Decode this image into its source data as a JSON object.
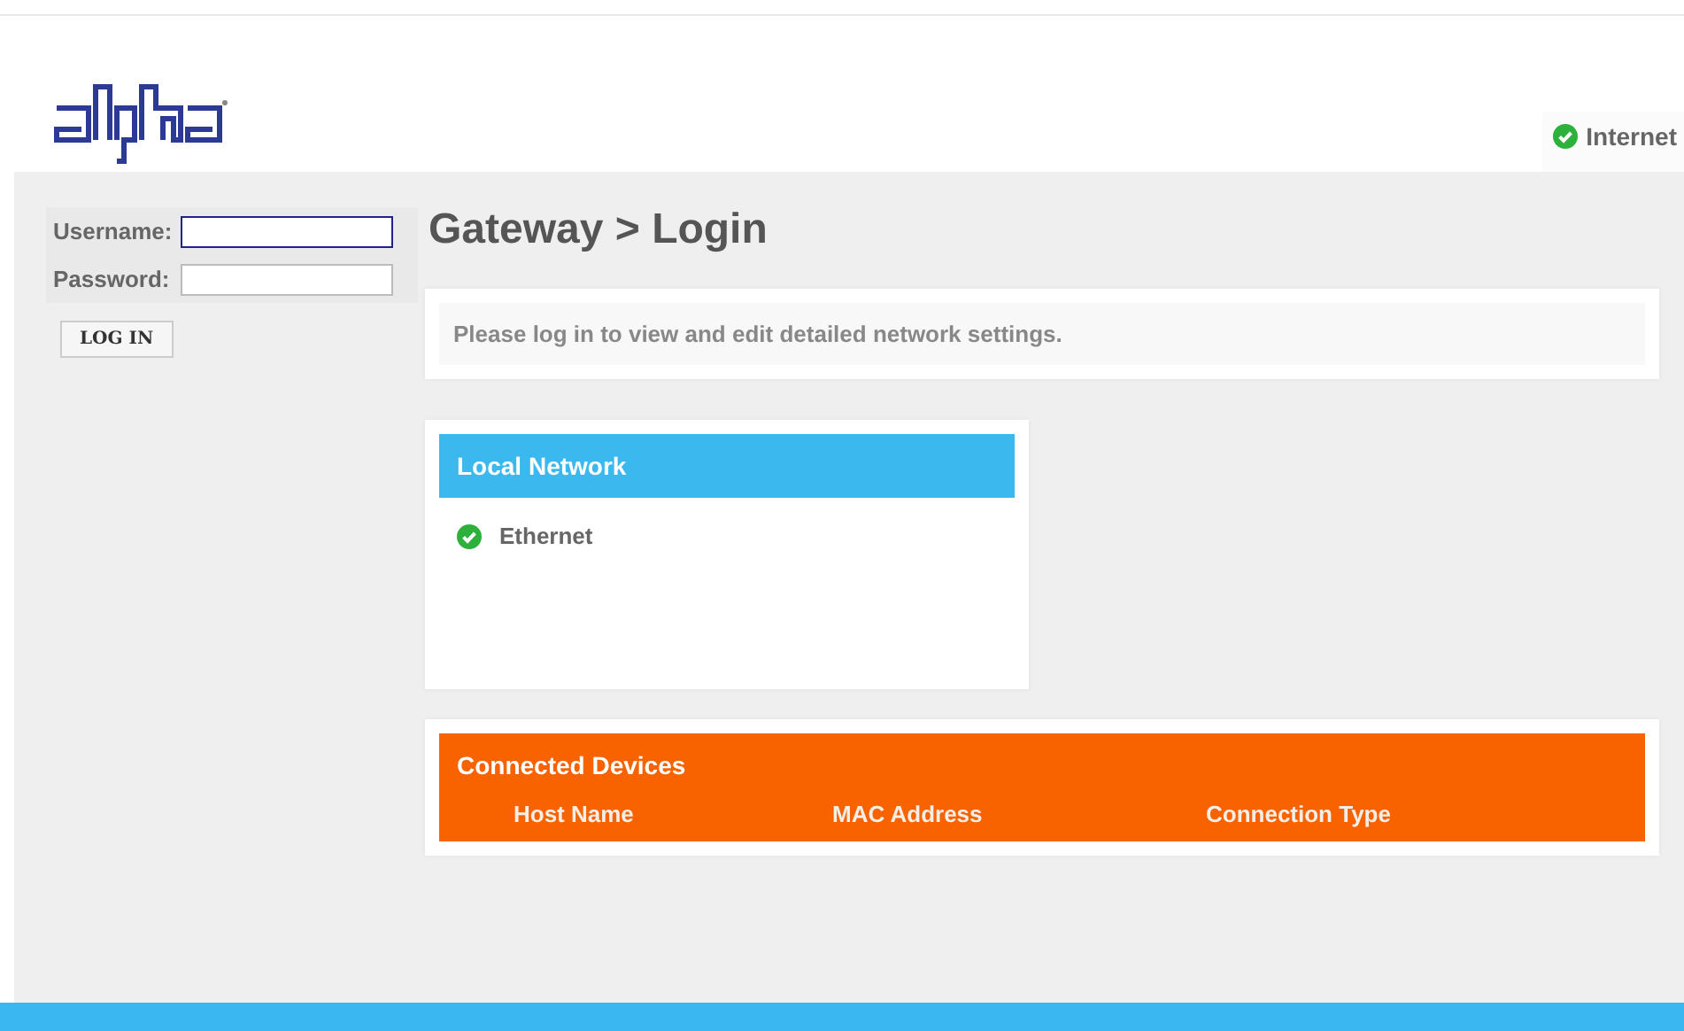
{
  "header": {
    "status": {
      "label": "Internet",
      "connected": true
    }
  },
  "login": {
    "fields": [
      {
        "label": "Username:",
        "focused": true
      },
      {
        "label": "Password:",
        "focused": false
      }
    ],
    "button": "LOG IN"
  },
  "page_title": "Gateway > Login",
  "message": "Please log in to view and edit detailed network settings.",
  "local_network": {
    "title": "Local Network",
    "items": [
      {
        "label": "Ethernet",
        "connected": true
      }
    ]
  },
  "connected_devices": {
    "title": "Connected Devices",
    "columns": [
      "Host Name",
      "MAC Address",
      "Connection Type"
    ]
  }
}
